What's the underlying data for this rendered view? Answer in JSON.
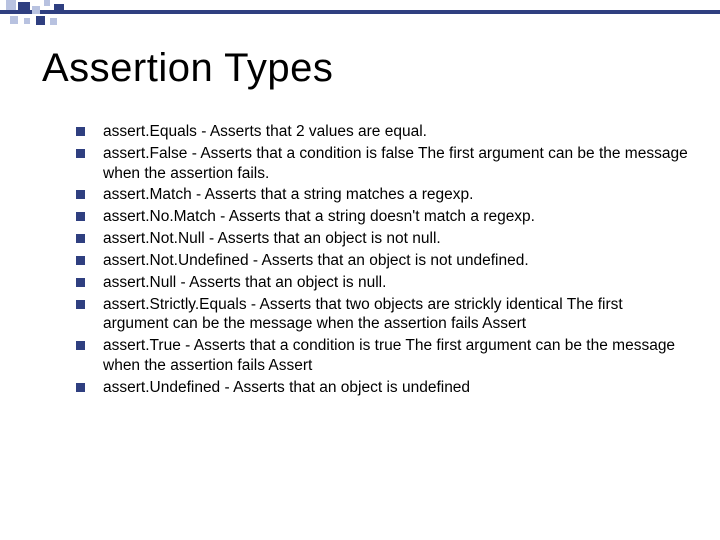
{
  "slide": {
    "title": "Assertion Types",
    "bullets": [
      "assert.Equals - Asserts that 2 values are equal.",
      "assert.False - Asserts that a condition is false The first argument can be   the message when the assertion fails.",
      "assert.Match - Asserts that a string matches a regexp.",
      "assert.No.Match - Asserts that a string doesn't match a regexp.",
      "assert.Not.Null - Asserts that an object is not null.",
      "assert.Not.Undefined - Asserts that an object is not undefined.",
      "assert.Null - Asserts that an object is null.",
      "assert.Strictly.Equals - Asserts that two objects are strickly identical The first argument can be the message when the assertion fails  Assert",
      "assert.True - Asserts that a condition is true The first argument can be the message when the assertion fails  Assert",
      " assert.Undefined - Asserts that an object is undefined"
    ]
  }
}
